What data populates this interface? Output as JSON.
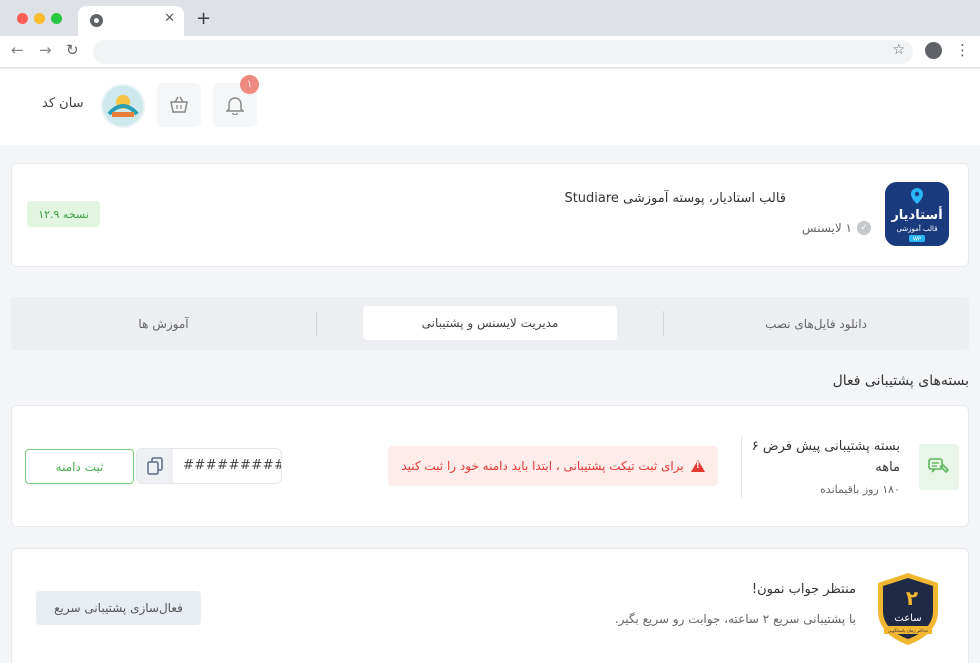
{
  "colors": {
    "accent_green": "#4caf50",
    "warning_red": "#e53935",
    "badge_red": "#ef8a80",
    "logo_blue": "#1a3a7e"
  },
  "browser": {
    "tab_close": "✕",
    "new_tab": "+",
    "back": "←",
    "forward": "→",
    "reload": "↻",
    "star": "☆",
    "menu": "⋮"
  },
  "header": {
    "username": "سان کد",
    "notification_count": "۱",
    "icons": [
      "bell-icon",
      "cart-icon",
      "avatar"
    ]
  },
  "product": {
    "title": "قالب استادیار، پوسته آموزشی Studiare",
    "license": "۱ لایسنس",
    "version": "نسخه ۱۲.۹",
    "logo_text": "أستادیار",
    "logo_sub": "قالب آموزشی",
    "logo_tag": "WP"
  },
  "tabs": [
    {
      "label": "دانلود فایل‌های نصب",
      "active": false
    },
    {
      "label": "مدیریت لایسنس و پشتیبانی",
      "active": true
    },
    {
      "label": "آموزش ها",
      "active": false
    }
  ],
  "section_title": "بسته‌های پشتیبانی فعال",
  "support_package": {
    "title": "بسته پشتیبانی پیش فرض ۶ ماهه",
    "remaining": "۱۸۰ روز باقیمانده",
    "warning": "برای ثبت تیکت پشتیبانی ، ابتدا باید دامنه خود را ثبت کنید",
    "domain_value": "###########",
    "register_button": "ثبت دامنه"
  },
  "fast_support": {
    "title": "منتظر جواب نمون!",
    "description": "با پشتیبانی سریع ۲ ساعته، جوابت رو سریع بگیر.",
    "button": "فعال‌سازی پشتیبانی سریع",
    "badge_number": "۲",
    "badge_word": "ساعت",
    "badge_caption": "حداکثر زمان پاسخگویی"
  }
}
